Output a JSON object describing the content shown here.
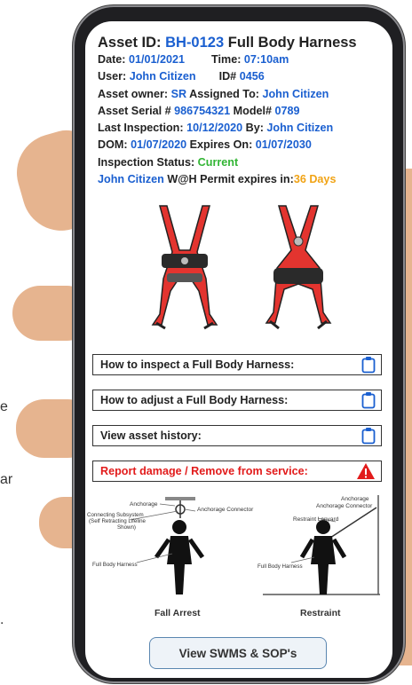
{
  "background_text": [
    "e",
    "ar",
    "."
  ],
  "asset": {
    "id_label": "Asset ID: ",
    "id": "BH-0123",
    "name": " Full Body Harness",
    "date_label": "Date: ",
    "date": "01/01/2021",
    "time_label": "Time: ",
    "time": "07:10am",
    "user_label": "User: ",
    "user": "John Citizen",
    "user_id_label": "ID# ",
    "user_id": "0456",
    "owner_label": "Asset owner: ",
    "owner": "SR",
    "assigned_label": " Assigned To: ",
    "assigned": "John Citizen",
    "serial_label": "Asset Serial # ",
    "serial": "986754321",
    "model_label": "  Model# ",
    "model": "0789",
    "last_insp_label": "Last Inspection: ",
    "last_insp": "10/12/2020",
    "by_label": " By: ",
    "by": "John Citizen",
    "dom_label": "DOM: ",
    "dom": "01/07/2020",
    "expires_label": "  Expires On: ",
    "expires": "01/07/2030",
    "status_label": "Inspection Status: ",
    "status": "Current",
    "permit_user": "John Citizen",
    "permit_label": " W@H Permit expires in:",
    "permit_days": "36 Days"
  },
  "actions": {
    "inspect": "How to inspect a Full Body Harness:",
    "adjust": "How to adjust a Full Body Harness:",
    "history": "View asset history:",
    "report": "Report damage / Remove from service:"
  },
  "diagram": {
    "left_title": "Fall Arrest",
    "right_title": "Restraint",
    "anchorage": "Anchorage",
    "anchorage_connector": "Anchorage Connector",
    "connecting_1": "Connecting Subsystem",
    "connecting_2": "(Self Retracting Lifeline",
    "connecting_3": "Shown)",
    "harness": "Full Body Harness",
    "restraint_lanyard": "Restraint Lanyard"
  },
  "swms_button": "View SWMS & SOP's",
  "colors": {
    "blue": "#1a5fd0",
    "green": "#32b534",
    "orange": "#f1a315",
    "red": "#e21b1b"
  }
}
